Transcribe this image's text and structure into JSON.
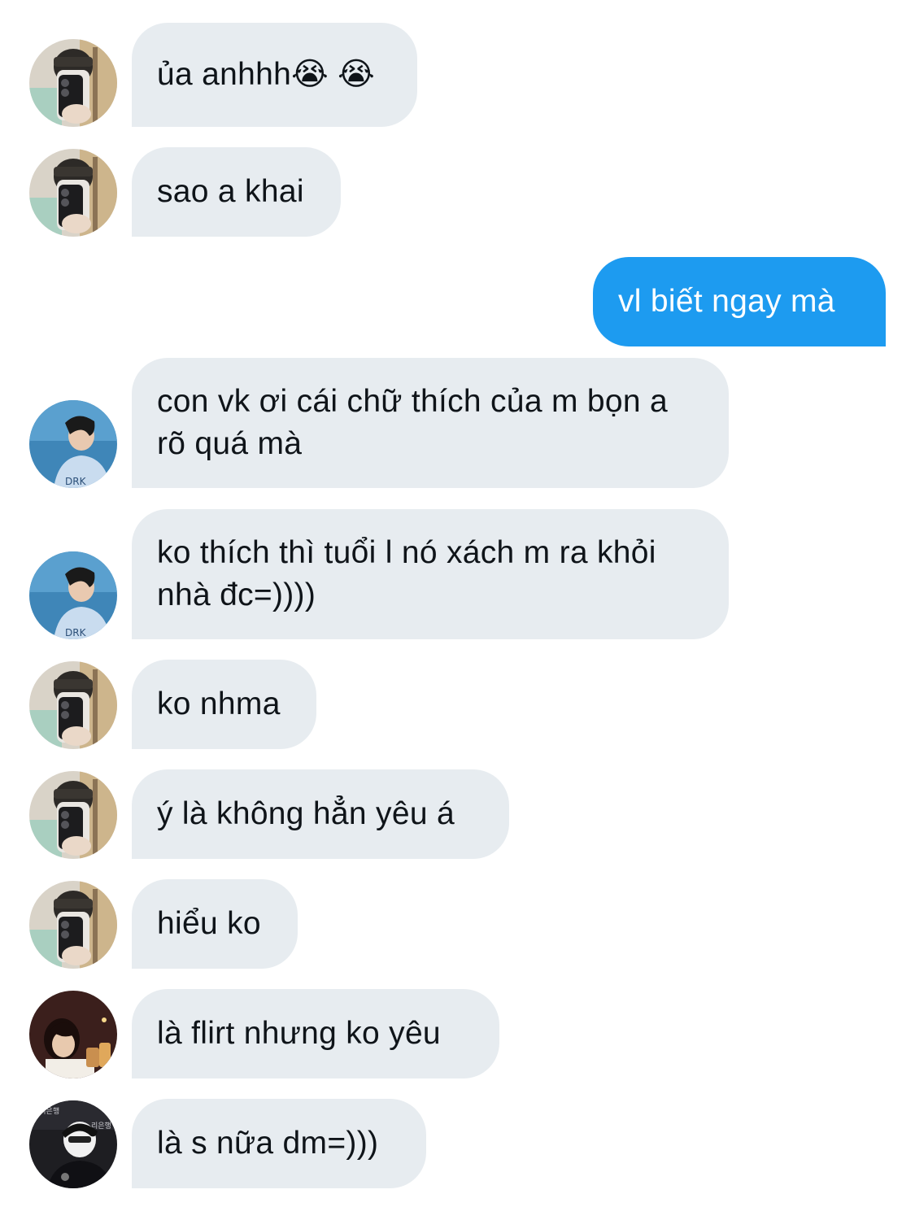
{
  "conversation": {
    "messages": [
      {
        "text": "ủa anhhh😭 😭",
        "direction": "incoming",
        "avatar": "user-a-avatar"
      },
      {
        "text": "sao a khai",
        "direction": "incoming",
        "avatar": "user-a-avatar"
      },
      {
        "text": "vl biết ngay mà",
        "direction": "outgoing"
      },
      {
        "text": "con vk ơi cái chữ thích của m bọn a rõ quá mà",
        "direction": "incoming",
        "avatar": "user-b-avatar"
      },
      {
        "text": "ko thích thì tuổi l nó xách m ra khỏi nhà đc=))))",
        "direction": "incoming",
        "avatar": "user-b-avatar"
      },
      {
        "text": "ko nhma",
        "direction": "incoming",
        "avatar": "user-a-avatar"
      },
      {
        "text": "ý là không hẳn yêu á",
        "direction": "incoming",
        "avatar": "user-a-avatar"
      },
      {
        "text": "hiểu ko",
        "direction": "incoming",
        "avatar": "user-a-avatar"
      },
      {
        "text": "là flirt nhưng ko yêu",
        "direction": "incoming",
        "avatar": "user-c-avatar"
      },
      {
        "text": "là s nữa dm=)))",
        "direction": "incoming",
        "avatar": "user-d-avatar"
      }
    ]
  },
  "colors": {
    "incoming_bubble": "#e7ecf0",
    "outgoing_bubble": "#1d9bf0",
    "incoming_text": "#0f1419",
    "outgoing_text": "#ffffff"
  }
}
